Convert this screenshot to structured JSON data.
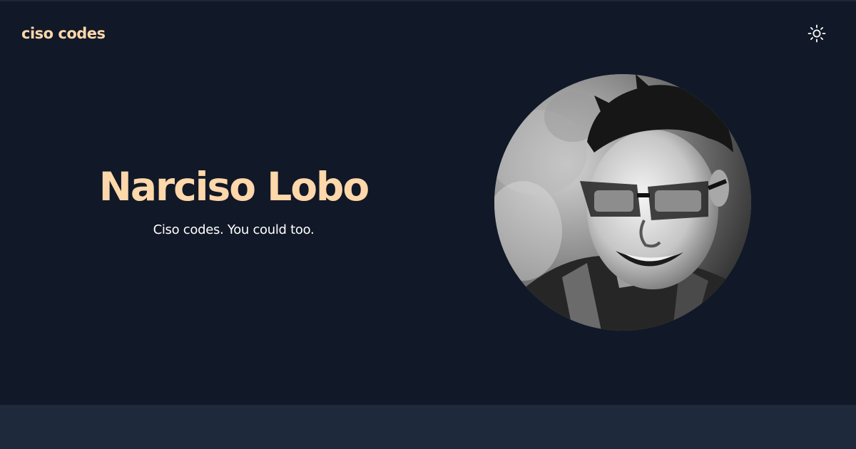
{
  "header": {
    "site_title": "ciso codes",
    "theme_toggle_icon": "sun-icon"
  },
  "hero": {
    "name": "Narciso Lobo",
    "tagline": "Ciso codes. You could too.",
    "portrait_icon": "portrait-photo"
  },
  "colors": {
    "background": "#111827",
    "accent": "#fed7aa",
    "text": "#ffffff",
    "footer": "#1e293b"
  }
}
